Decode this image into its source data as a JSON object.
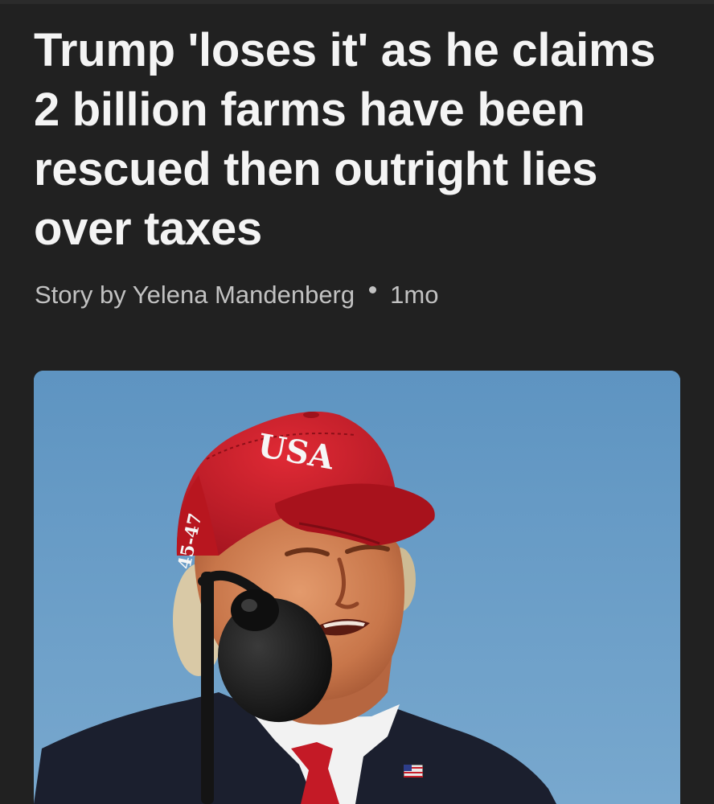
{
  "article": {
    "headline": "Trump 'loses it' as he claims 2 billion farms have been rescued then outright lies over taxes",
    "byline": {
      "author_text": "Story by Yelena Mandenberg",
      "age": "1mo"
    },
    "hero_image": {
      "cap_front_text": "USA",
      "cap_side_text": "45-47",
      "colors": {
        "sky": "#6a9dc8",
        "cap": "#c81f2a",
        "suit": "#1b1f2e",
        "tie": "#c41a26"
      }
    }
  },
  "theme": {
    "background": "#212121",
    "headline_color": "#f4f4f4",
    "meta_color": "#c2c2c2"
  }
}
